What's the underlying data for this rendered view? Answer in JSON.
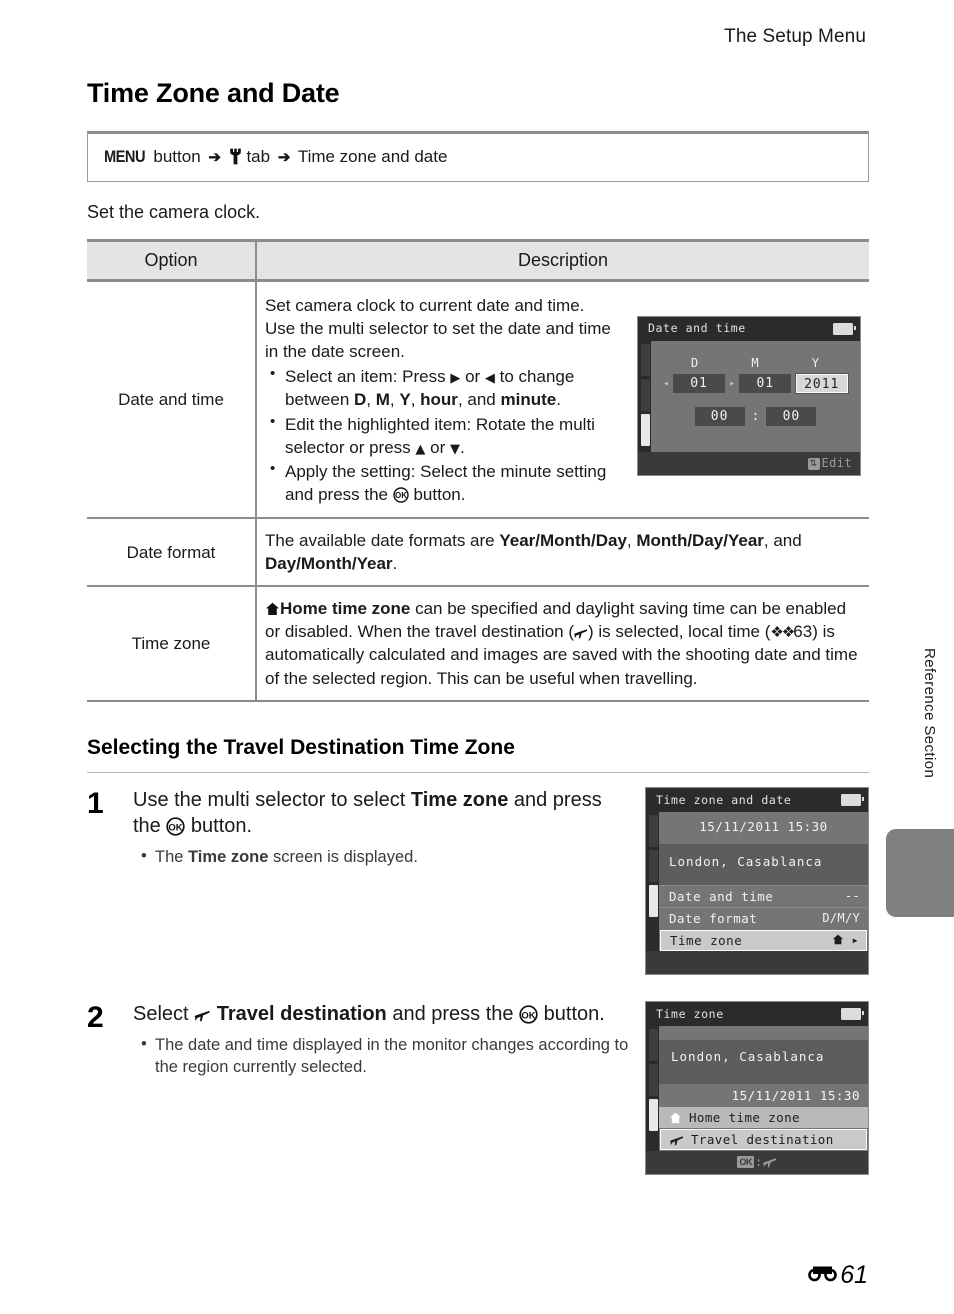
{
  "header": {
    "running_head": "The Setup Menu"
  },
  "title": "Time Zone and Date",
  "menu_path": {
    "menu_label": "MENU",
    "button_word": "button",
    "arrow": "➔",
    "tab_icon": "Y",
    "tab_word": "tab",
    "destination": "Time zone and date"
  },
  "lead": "Set the camera clock.",
  "table": {
    "headers": {
      "option": "Option",
      "description": "Description"
    },
    "rows": [
      {
        "option": "Date and time",
        "desc_p1": "Set camera clock to current date and time.",
        "desc_p2": "Use the multi selector to set the date and time in the date screen.",
        "bullets": [
          {
            "pre": "Select an item: Press ",
            "a1": "▶",
            "mid": " or ",
            "a2": "◀",
            "post": " to change between ",
            "b1": "D",
            "s1": ", ",
            "b2": "M",
            "s2": ", ",
            "b3": "Y",
            "s3": ", ",
            "b4": "hour",
            "s4": ", and ",
            "b5": "minute",
            "end": "."
          },
          {
            "pre": "Edit the highlighted item: Rotate the multi selector or press ",
            "a1": "▲",
            "mid": " or ",
            "a2": "▼",
            "post": "."
          },
          {
            "pre": "Apply the setting: Select the minute setting and press the ",
            "ok": "ⓀⓀ",
            "post": " button."
          }
        ]
      },
      {
        "option": "Date format",
        "text_1": "The available date formats are ",
        "bold_1": "Year/Month/Day",
        "text_2": ", ",
        "bold_2": "Month/Day/Year",
        "text_3": ", and ",
        "bold_3": "Day/Month/Year",
        "text_4": "."
      },
      {
        "option": "Time zone",
        "home_icon": "⌂",
        "bold_1": "Home time zone",
        "text_1": " can be specified and daylight saving time can be enabled or disabled. When the travel destination (",
        "plane_icon": "✈",
        "text_2": ") is selected, local time (",
        "ref_icon": "E",
        "ref_page": "63",
        "text_3": ") is automatically calculated and images are saved with the shooting date and time of the selected region. This can be useful when travelling."
      }
    ]
  },
  "subsection": {
    "heading": "Selecting the Travel Destination Time Zone",
    "steps": [
      {
        "num": "1",
        "main_pre": "Use the multi selector to select ",
        "main_bold": "Time zone",
        "main_mid": " and press the ",
        "main_ok": "Ⓚ",
        "main_post": " button.",
        "bullet_pre": "The ",
        "bullet_bold": "Time zone",
        "bullet_post": " screen is displayed."
      },
      {
        "num": "2",
        "main_pre": "Select ",
        "main_icon": "✈",
        "main_bold": "Travel destination",
        "main_mid": " and press the ",
        "main_ok": "Ⓚ",
        "main_post": " button.",
        "bullet": "The date and time displayed in the monitor changes according to the region currently selected."
      }
    ]
  },
  "screens": {
    "date_and_time": {
      "title": "Date and time",
      "battery_icon": "battery-icon",
      "labels": {
        "d": "D",
        "m": "M",
        "y": "Y"
      },
      "values": {
        "day": "01",
        "month": "01",
        "year": "2011",
        "hour": "00",
        "colon": ":",
        "minute": "00"
      },
      "highlighted_field": "year",
      "footer_icon": "up-down-arrow-icon",
      "footer_glyph": "⇅",
      "footer_label": "Edit"
    },
    "time_zone_and_date": {
      "title": "Time zone and date",
      "datetime": "15/11/2011 15:30",
      "city": "London, Casablanca",
      "rows": [
        {
          "label": "Date and time",
          "value": "--"
        },
        {
          "label": "Date format",
          "value": "D/M/Y"
        },
        {
          "label": "Time zone",
          "value": "⌂",
          "value_arrow": "▸",
          "selected": true
        }
      ]
    },
    "time_zone": {
      "title": "Time zone",
      "city": "London, Casablanca",
      "datetime": "15/11/2011 15:30",
      "items": [
        {
          "icon": "⌂",
          "label": "Home time zone",
          "state": "normal"
        },
        {
          "icon": "✈",
          "label": "Travel destination",
          "state": "selected"
        }
      ],
      "footer_ok": "OK",
      "footer_sep": ":",
      "footer_icon": "✈"
    }
  },
  "side_label": "Reference Section",
  "footer": {
    "section_icon": "E",
    "page_number": "61"
  }
}
